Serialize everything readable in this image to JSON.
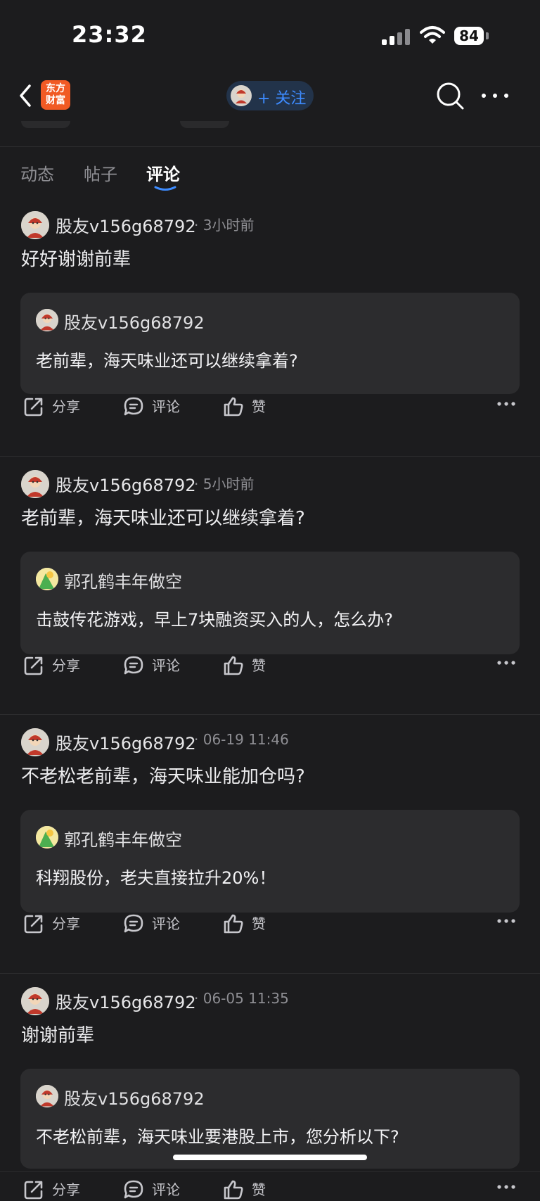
{
  "status_bar": {
    "time": "23:32",
    "battery": "84"
  },
  "nav": {
    "logo_text": "东方财富",
    "follow_label": "+ 关注"
  },
  "tabs": [
    {
      "label": "动态"
    },
    {
      "label": "帖子"
    },
    {
      "label": "评论"
    }
  ],
  "actions": {
    "share": "分享",
    "comment": "评论",
    "like": "赞"
  },
  "posts": [
    {
      "author": "股友v156g68792",
      "time": "· 3小时前",
      "body": "好好谢谢前辈",
      "quote": {
        "author": "股友v156g68792",
        "text": "老前辈，海天味业还可以继续拿着?"
      }
    },
    {
      "author": "股友v156g68792",
      "time": "· 5小时前",
      "body": "老前辈，海天味业还可以继续拿着?",
      "quote": {
        "author": "郭孔鹤丰年做空",
        "text": "击鼓传花游戏，早上7块融资买入的人，怎么办?"
      }
    },
    {
      "author": "股友v156g68792",
      "time": "· 06-19 11:46",
      "body": "不老松老前辈，海天味业能加仓吗?",
      "quote": {
        "author": "郭孔鹤丰年做空",
        "text": "科翔股份，老夫直接拉升20%！"
      }
    },
    {
      "author": "股友v156g68792",
      "time": "· 06-05 11:35",
      "body": "谢谢前辈",
      "quote": {
        "author": "股友v156g68792",
        "text": "不老松前辈，海天味业要港股上市，您分析以下?"
      }
    }
  ],
  "colors": {
    "background": "#1c1c1e",
    "card": "#2c2c2e",
    "accent": "#3d8bff",
    "brand": "#f15a24"
  }
}
